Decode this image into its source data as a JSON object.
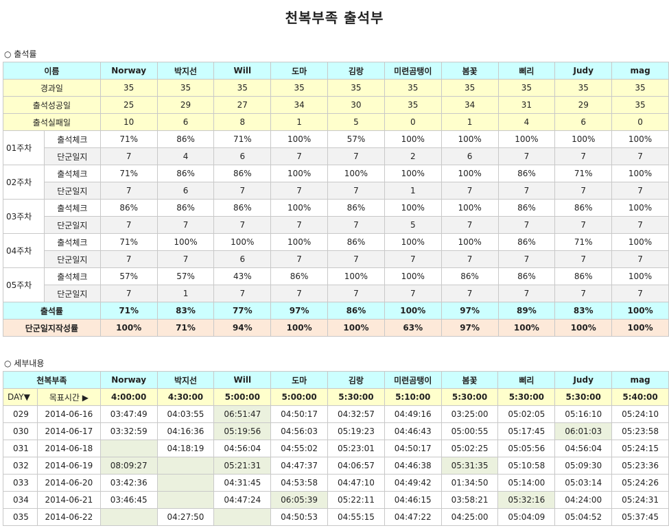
{
  "title": "천복부족 출석부",
  "attendance": {
    "section_label": "○ 출석률",
    "header_label": "이름",
    "names": [
      "Norway",
      "박지선",
      "Will",
      "도마",
      "김랑",
      "미련곰탱이",
      "봄꽃",
      "삐리",
      "Judy",
      "mag"
    ],
    "rows": [
      {
        "label": "경과일",
        "values": [
          "35",
          "35",
          "35",
          "35",
          "35",
          "35",
          "35",
          "35",
          "35",
          "35"
        ]
      },
      {
        "label": "출석성공일",
        "values": [
          "25",
          "29",
          "27",
          "34",
          "30",
          "35",
          "34",
          "31",
          "29",
          "35"
        ]
      },
      {
        "label": "출석실패일",
        "values": [
          "10",
          "6",
          "8",
          "1",
          "5",
          "0",
          "1",
          "4",
          "6",
          "0"
        ]
      }
    ],
    "weeks": [
      {
        "label": "01주차",
        "check_label": "출석체크",
        "diary_label": "단군일지",
        "check": [
          "71%",
          "86%",
          "71%",
          "100%",
          "57%",
          "100%",
          "100%",
          "100%",
          "100%",
          "100%"
        ],
        "diary": [
          "7",
          "4",
          "6",
          "7",
          "7",
          "2",
          "6",
          "7",
          "7",
          "7"
        ]
      },
      {
        "label": "02주차",
        "check_label": "출석체크",
        "diary_label": "단군일지",
        "check": [
          "71%",
          "86%",
          "86%",
          "100%",
          "100%",
          "100%",
          "100%",
          "86%",
          "71%",
          "100%"
        ],
        "diary": [
          "7",
          "6",
          "7",
          "7",
          "7",
          "1",
          "7",
          "7",
          "7",
          "7"
        ]
      },
      {
        "label": "03주차",
        "check_label": "출석체크",
        "diary_label": "단군일지",
        "check": [
          "86%",
          "86%",
          "86%",
          "100%",
          "86%",
          "100%",
          "100%",
          "86%",
          "86%",
          "100%"
        ],
        "diary": [
          "7",
          "7",
          "7",
          "7",
          "7",
          "5",
          "7",
          "7",
          "7",
          "7"
        ]
      },
      {
        "label": "04주차",
        "check_label": "출석체크",
        "diary_label": "단군일지",
        "check": [
          "71%",
          "100%",
          "100%",
          "100%",
          "86%",
          "100%",
          "100%",
          "86%",
          "71%",
          "100%"
        ],
        "diary": [
          "7",
          "7",
          "6",
          "7",
          "7",
          "7",
          "7",
          "7",
          "7",
          "7"
        ]
      },
      {
        "label": "05주차",
        "check_label": "출석체크",
        "diary_label": "단군일지",
        "check": [
          "57%",
          "57%",
          "43%",
          "86%",
          "100%",
          "100%",
          "86%",
          "86%",
          "86%",
          "100%"
        ],
        "diary": [
          "7",
          "1",
          "7",
          "7",
          "7",
          "7",
          "7",
          "7",
          "7",
          "7"
        ]
      }
    ],
    "rate": {
      "label": "출석률",
      "values": [
        "71%",
        "83%",
        "77%",
        "97%",
        "86%",
        "100%",
        "97%",
        "89%",
        "83%",
        "100%"
      ]
    },
    "diary_rate": {
      "label": "단군일지작성률",
      "values": [
        "100%",
        "71%",
        "94%",
        "100%",
        "100%",
        "63%",
        "97%",
        "100%",
        "100%",
        "100%"
      ]
    }
  },
  "details": {
    "section_label": "○ 세부내용",
    "header_label": "천복부족",
    "names": [
      "Norway",
      "박지선",
      "Will",
      "도마",
      "김랑",
      "미련곰탱이",
      "봄꽃",
      "삐리",
      "Judy",
      "mag"
    ],
    "day_label": "DAY▼",
    "goal_label": "목표시간 ▶",
    "goals": [
      "4:00:00",
      "4:30:00",
      "5:00:00",
      "5:00:00",
      "5:30:00",
      "5:10:00",
      "5:30:00",
      "5:30:00",
      "5:30:00",
      "5:40:00"
    ],
    "rows": [
      {
        "day": "029",
        "date": "2014-06-16",
        "times": [
          "03:47:49",
          "04:03:55",
          "06:51:47",
          "04:50:17",
          "04:32:57",
          "04:49:16",
          "03:25:00",
          "05:02:05",
          "05:16:10",
          "05:24:10"
        ],
        "late": [
          2
        ]
      },
      {
        "day": "030",
        "date": "2014-06-17",
        "times": [
          "03:32:59",
          "04:16:36",
          "05:19:56",
          "04:56:03",
          "05:19:23",
          "04:46:43",
          "05:00:55",
          "05:17:45",
          "06:01:03",
          "05:23:58"
        ],
        "late": [
          2,
          8
        ]
      },
      {
        "day": "031",
        "date": "2014-06-18",
        "times": [
          "",
          "04:18:19",
          "04:56:04",
          "04:55:02",
          "05:23:01",
          "04:50:17",
          "05:02:25",
          "05:05:56",
          "04:56:04",
          "05:24:15"
        ],
        "late": [
          0
        ]
      },
      {
        "day": "032",
        "date": "2014-06-19",
        "times": [
          "08:09:27",
          "",
          "05:21:31",
          "04:47:37",
          "04:06:57",
          "04:46:38",
          "05:31:35",
          "05:10:58",
          "05:09:30",
          "05:23:36"
        ],
        "late": [
          0,
          1,
          2,
          6
        ]
      },
      {
        "day": "033",
        "date": "2014-06-20",
        "times": [
          "03:42:36",
          "",
          "04:31:45",
          "04:53:58",
          "04:47:10",
          "04:49:42",
          "01:34:50",
          "05:14:00",
          "05:03:14",
          "05:24:26"
        ],
        "late": [
          1
        ]
      },
      {
        "day": "034",
        "date": "2014-06-21",
        "times": [
          "03:46:45",
          "",
          "04:47:24",
          "06:05:39",
          "05:22:11",
          "04:46:15",
          "03:58:21",
          "05:32:16",
          "04:24:00",
          "05:24:31"
        ],
        "late": [
          1,
          3,
          7
        ]
      },
      {
        "day": "035",
        "date": "2014-06-22",
        "times": [
          "",
          "04:27:50",
          "",
          "04:50:53",
          "04:55:15",
          "04:47:22",
          "04:25:00",
          "05:04:09",
          "05:04:52",
          "05:37:45"
        ],
        "late": [
          0,
          2
        ]
      }
    ]
  }
}
